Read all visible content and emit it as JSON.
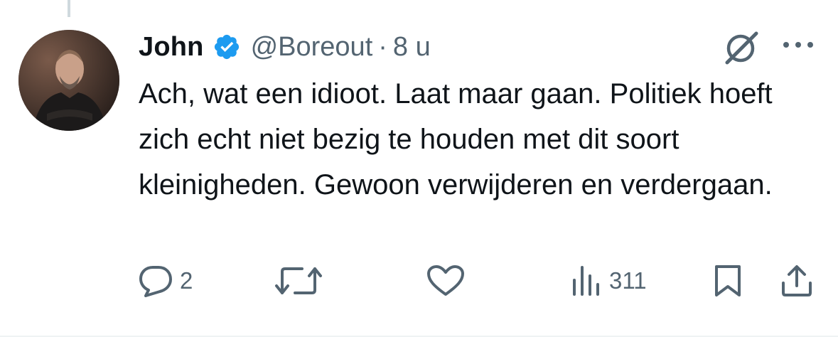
{
  "tweet": {
    "author_name": "John",
    "handle": "@Boreout",
    "separator": "·",
    "time": "8 u",
    "text": "Ach, wat een idioot. Laat maar gaan. Politiek hoeft zich echt niet bezig te houden met dit soort kleinigheden. Gewoon verwijderen en verdergaan."
  },
  "actions": {
    "reply_count": "2",
    "views_count": "311"
  },
  "icons": {
    "avatar": "avatar-photo",
    "verified": "verified-badge-icon",
    "grok": "grok-icon",
    "more": "more-dots-icon",
    "reply": "reply-icon",
    "repost": "repost-icon",
    "like": "heart-icon",
    "views": "views-bar-chart-icon",
    "bookmark": "bookmark-icon",
    "share": "share-icon"
  },
  "colors": {
    "text": "#0f1419",
    "secondary": "#536471",
    "verified": "#1d9bf0",
    "thread_line": "#cfd9de"
  }
}
